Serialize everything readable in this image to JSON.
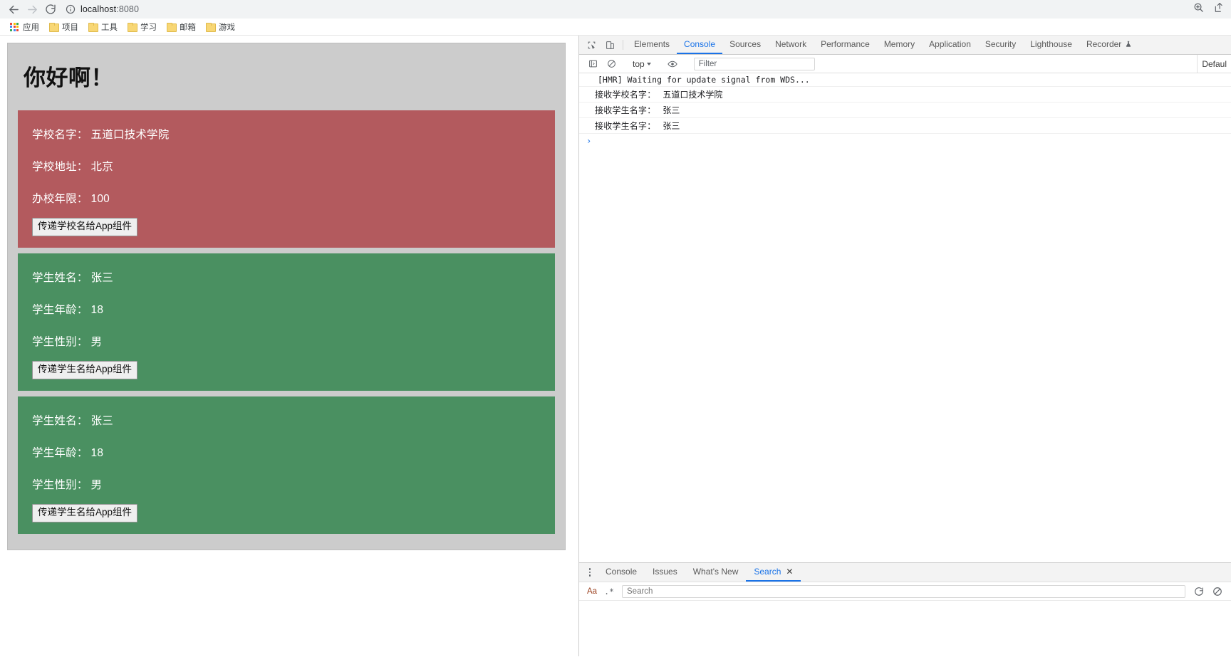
{
  "browser": {
    "back_title": "Back",
    "forward_title": "Forward",
    "reload_title": "Reload",
    "url_host": "localhost",
    "url_port": ":8080",
    "site_info_icon": "info-circle-icon",
    "zoom_icon": "zoom-in-icon",
    "bookmarks": [
      {
        "label": "应用",
        "icon": "apps-grid-icon"
      },
      {
        "label": "项目",
        "icon": "folder-icon"
      },
      {
        "label": "工具",
        "icon": "folder-icon"
      },
      {
        "label": "学习",
        "icon": "folder-icon"
      },
      {
        "label": "邮箱",
        "icon": "folder-icon"
      },
      {
        "label": "游戏",
        "icon": "folder-icon"
      }
    ]
  },
  "page": {
    "greeting": "你好啊！",
    "school_card": {
      "bg": "#b35a5e",
      "rows": [
        {
          "label": "学校名字：",
          "value": "五道口技术学院"
        },
        {
          "label": "学校地址：",
          "value": "北京"
        },
        {
          "label": "办校年限：",
          "value": "100"
        }
      ],
      "button_label": "传递学校名给App组件"
    },
    "student_cards": [
      {
        "bg": "#4a9061",
        "rows": [
          {
            "label": "学生姓名：",
            "value": "张三"
          },
          {
            "label": "学生年龄：",
            "value": "18"
          },
          {
            "label": "学生性别：",
            "value": "男"
          }
        ],
        "button_label": "传递学生名给App组件"
      },
      {
        "bg": "#4a9061",
        "rows": [
          {
            "label": "学生姓名：",
            "value": "张三"
          },
          {
            "label": "学生年龄：",
            "value": "18"
          },
          {
            "label": "学生性别：",
            "value": "男"
          }
        ],
        "button_label": "传递学生名给App组件"
      }
    ]
  },
  "devtools": {
    "inspect_icon": "inspect-element-icon",
    "device_icon": "device-toolbar-icon",
    "tabs": [
      {
        "label": "Elements",
        "active": false
      },
      {
        "label": "Console",
        "active": true
      },
      {
        "label": "Sources",
        "active": false
      },
      {
        "label": "Network",
        "active": false
      },
      {
        "label": "Performance",
        "active": false
      },
      {
        "label": "Memory",
        "active": false
      },
      {
        "label": "Application",
        "active": false
      },
      {
        "label": "Security",
        "active": false
      },
      {
        "label": "Lighthouse",
        "active": false
      },
      {
        "label": "Recorder",
        "active": false,
        "badge_icon": "flask-icon"
      }
    ],
    "console_toolbar": {
      "sidebar_icon": "console-sidebar-icon",
      "clear_icon": "clear-console-icon",
      "context": "top",
      "eye_icon": "live-expression-icon",
      "filter_placeholder": "Filter",
      "level_label": "Defaul"
    },
    "console_messages": [
      {
        "text": "[HMR] Waiting for update signal from WDS...",
        "mono": true
      },
      {
        "label": "接收学校名字：",
        "value": "五道口技术学院",
        "mono": false
      },
      {
        "label": "接收学生名字：",
        "value": "张三",
        "mono": false
      },
      {
        "label": "接收学生名字：",
        "value": "张三",
        "mono": false
      }
    ],
    "prompt_symbol": "›",
    "drawer": {
      "menu_icon": "kebab-menu-icon",
      "tabs": [
        {
          "label": "Console",
          "active": false,
          "closable": false
        },
        {
          "label": "Issues",
          "active": false,
          "closable": false
        },
        {
          "label": "What's New",
          "active": false,
          "closable": false
        },
        {
          "label": "Search",
          "active": true,
          "closable": true,
          "close_glyph": "✕"
        }
      ],
      "search": {
        "match_case_label": "Aa",
        "regex_label": ".*",
        "placeholder": "Search",
        "refresh_icon": "refresh-icon",
        "clear_icon": "clear-icon"
      }
    }
  }
}
